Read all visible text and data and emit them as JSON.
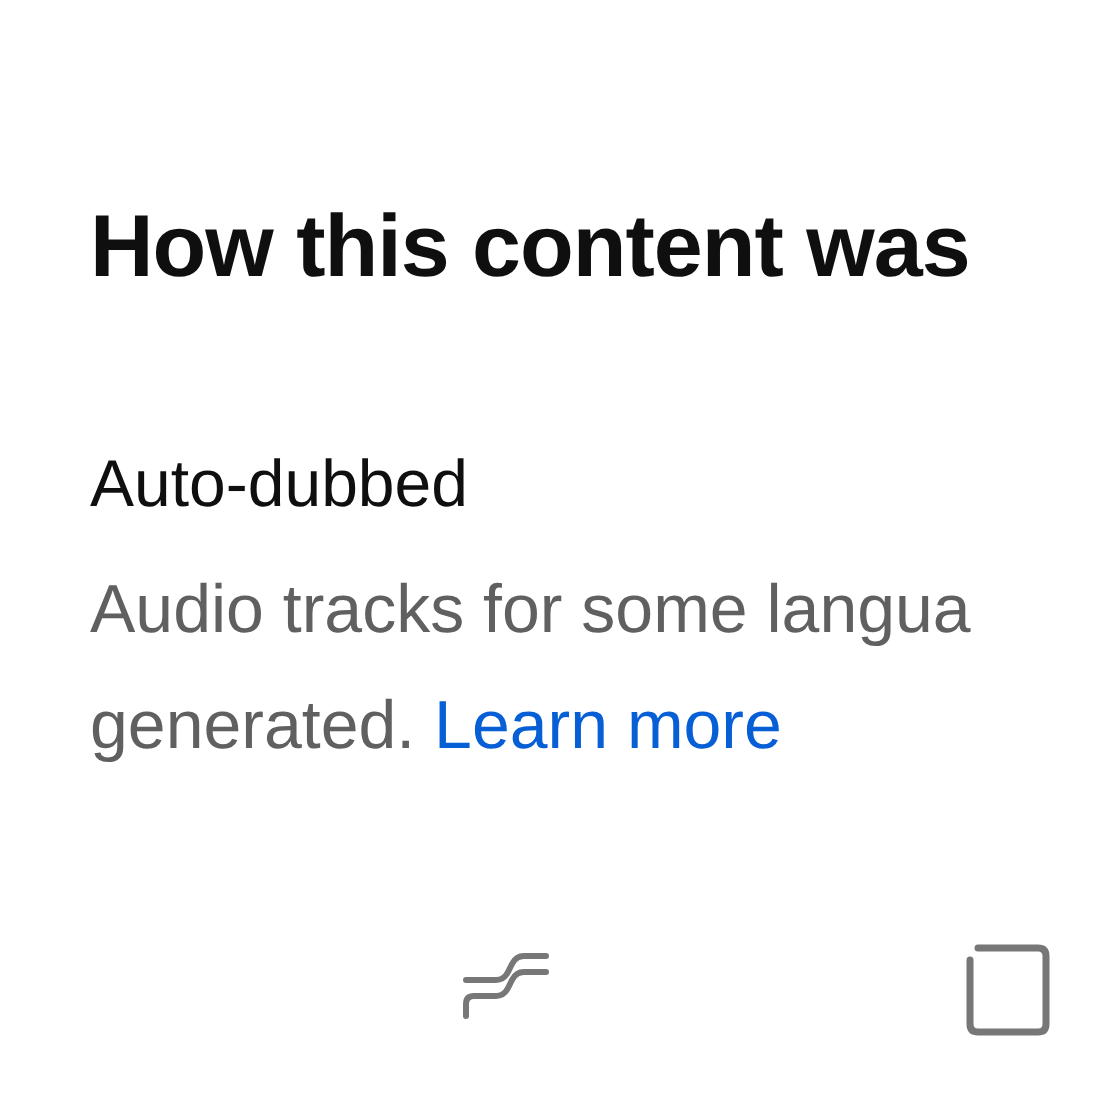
{
  "sheet": {
    "title": "How this content was",
    "section": {
      "heading": "Auto-dubbed",
      "description_lines": [
        "Audio tracks for some langua",
        "generated."
      ],
      "link": "Learn more"
    }
  },
  "nav_bar": {
    "buttons": [
      {
        "kind": "recents"
      },
      {
        "kind": "square"
      }
    ]
  }
}
